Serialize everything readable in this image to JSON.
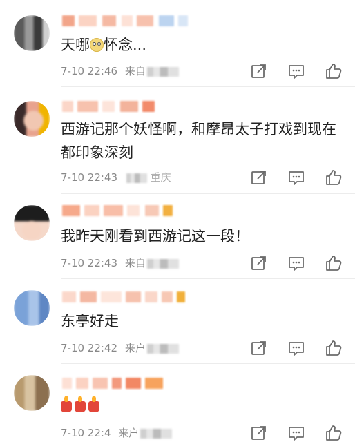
{
  "comments": [
    {
      "text": "天哪",
      "text_after_emoji": "怀念...",
      "emoji": "dizzy-face-emoji",
      "time": "7-10 22:46",
      "source": "来自"
    },
    {
      "text": "西游记那个妖怪啊，和摩昂太子打戏到现在都印象深刻",
      "time": "7-10 22:43",
      "source": "重庆"
    },
    {
      "text": "我昨天刚看到西游记这一段！",
      "time": "7-10 22:43",
      "source": "来自"
    },
    {
      "text": "东亭好走",
      "time": "7-10 22:42",
      "source": "来户"
    },
    {
      "text": "",
      "emoji": "candle-emoji",
      "time": "7-10 22:4",
      "source": "来户"
    }
  ],
  "icons": {
    "share": "share-icon",
    "comment": "comment-icon",
    "like": "thumbs-up-icon"
  },
  "colors": {
    "text": "#222222",
    "meta": "#888888",
    "icon": "#6b6b6b",
    "divider": "#ececec"
  }
}
